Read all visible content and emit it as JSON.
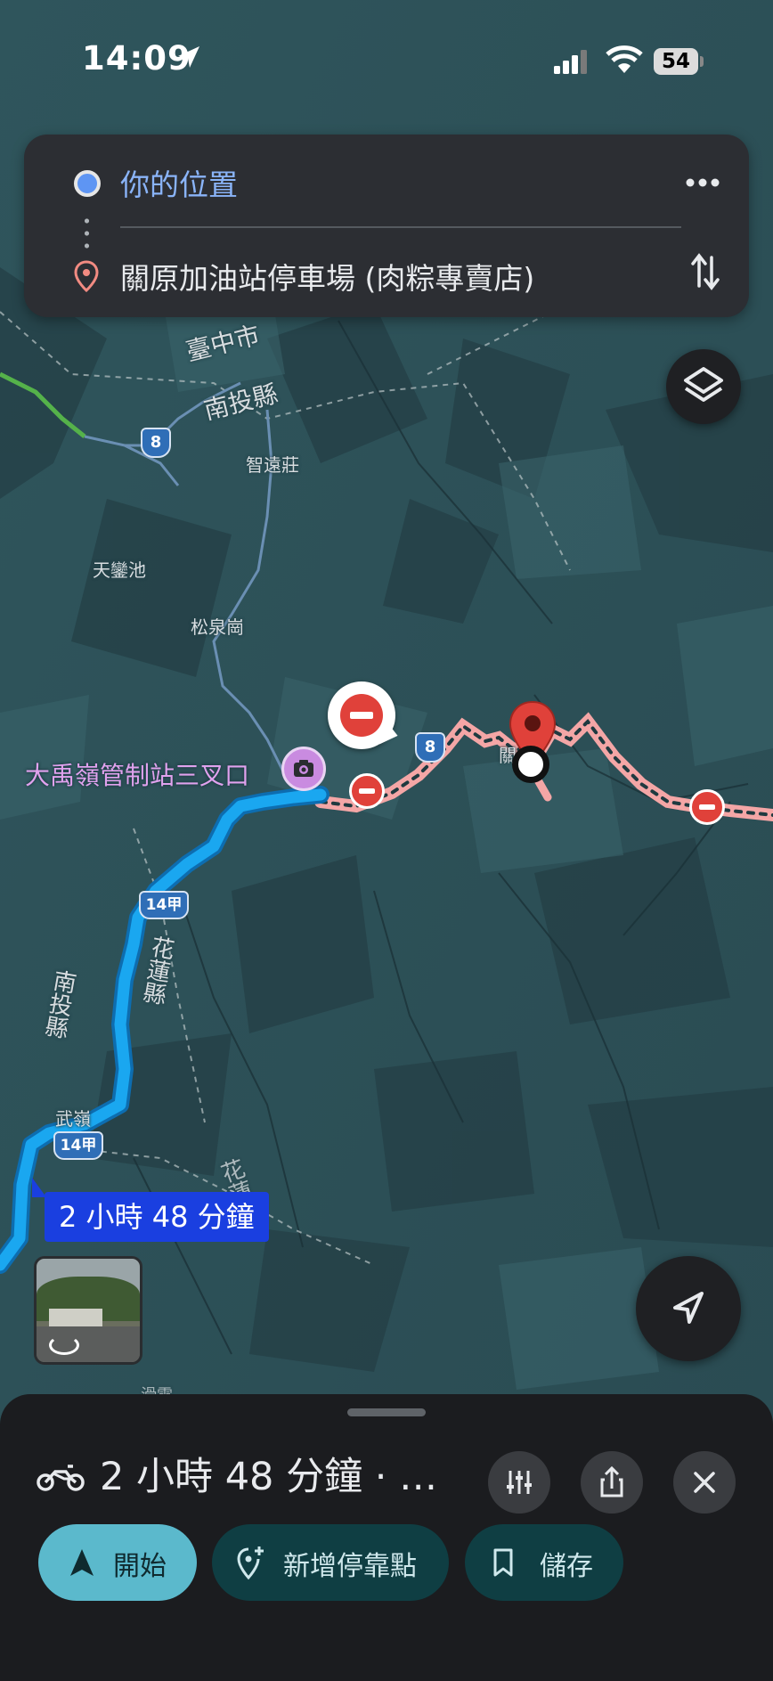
{
  "status_bar": {
    "time": "14:09",
    "battery": "54",
    "icons": [
      "location-arrow-icon",
      "cellular-signal-icon",
      "wifi-icon",
      "battery-icon"
    ]
  },
  "directions": {
    "origin": "你的位置",
    "destination": "關原加油站停車場 (肉粽專賣店)",
    "icons": [
      "origin-dot-icon",
      "destination-pin-icon",
      "more-icon",
      "swap-icon"
    ]
  },
  "map": {
    "place_labels": {
      "taichung": "臺中市",
      "nantou_top": "南投縣",
      "zhiyuanzhuang": "智遠莊",
      "tianluanchi": "天鑾池",
      "songquangang": "松泉崗",
      "nantou_left": "南投縣",
      "hualien": "花蓮縣",
      "hualien_lower": "花蓮縣",
      "wuling": "武嶺",
      "guan": "關",
      "bottom_label": "滑雪"
    },
    "road_shields": {
      "r8_top": "8",
      "r8_mid": "8",
      "r14a_upper": "14甲",
      "r14a_lower": "14甲"
    },
    "poi": "大禹嶺管制站三叉口",
    "eta_label": "2 小時 48 分鐘",
    "colors": {
      "route_primary": "#1aa7f0",
      "route_closed": "#f4a6a6",
      "destination_pin": "#e0413a",
      "poi": "#c98be0",
      "eta_bubble": "#1a3fe0"
    }
  },
  "bottom_sheet": {
    "summary": "2 小時 48 分鐘 · 1...",
    "buttons": {
      "start": "開始",
      "add_stop": "新增停靠點",
      "save": "儲存"
    },
    "icons": [
      "motorcycle-icon",
      "options-icon",
      "share-icon",
      "close-icon"
    ]
  }
}
